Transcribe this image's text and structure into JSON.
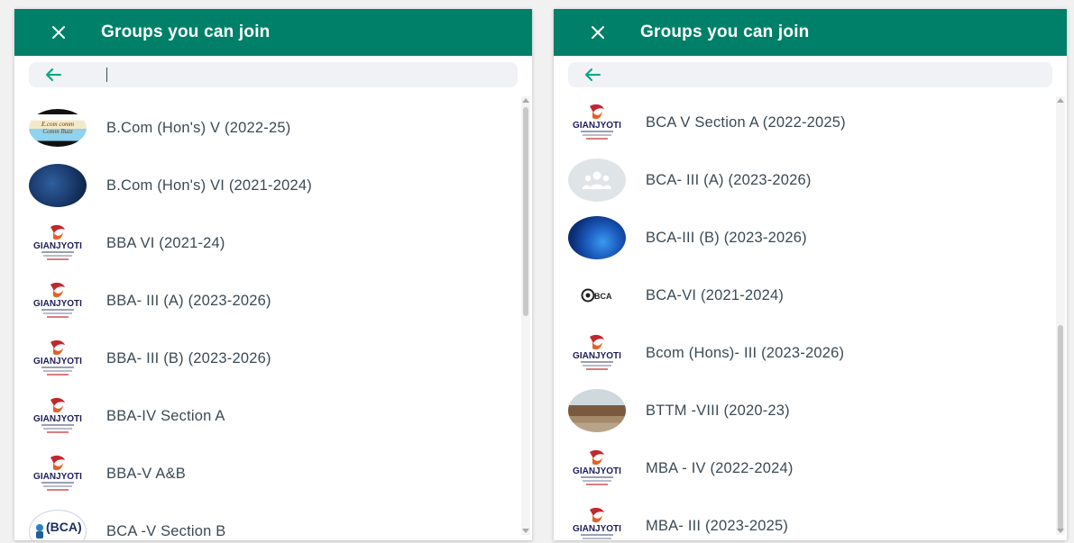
{
  "panels": [
    {
      "title": "Groups you can join",
      "search": {
        "value": "",
        "placeholder": ""
      },
      "groups": [
        {
          "name": "B.Com (Hon's) V (2022-25)",
          "avatar": "ecom-community-icon",
          "avatar_text": "E.com comm Comm Buzz"
        },
        {
          "name": "B.Com (Hon's) VI (2021-2024)",
          "avatar": "blue-abstract-photo"
        },
        {
          "name": "BBA VI (2021-24)",
          "avatar": "gianjyoti-logo-icon"
        },
        {
          "name": "BBA- III (A) (2023-2026)",
          "avatar": "gianjyoti-logo-icon"
        },
        {
          "name": "BBA- III (B) (2023-2026)",
          "avatar": "gianjyoti-logo-icon"
        },
        {
          "name": "BBA-IV Section A",
          "avatar": "gianjyoti-logo-icon"
        },
        {
          "name": "BBA-V A&B",
          "avatar": "gianjyoti-logo-icon"
        },
        {
          "name": "BCA -V Section B",
          "avatar": "bca-department-icon",
          "avatar_text": "(BCA)"
        }
      ]
    },
    {
      "title": "Groups you can join",
      "search": {
        "value": "",
        "placeholder": ""
      },
      "groups": [
        {
          "name": "BCA V Section A (2022-2025)",
          "avatar": "gianjyoti-logo-icon"
        },
        {
          "name": "BCA- III (A) (2023-2026)",
          "avatar": "default-group-icon"
        },
        {
          "name": "BCA-III (B) (2023-2026)",
          "avatar": "blue-globe-photo"
        },
        {
          "name": "BCA-VI (2021-2024)",
          "avatar": "bca-logo-icon",
          "avatar_text": "BCA"
        },
        {
          "name": "Bcom (Hons)- III (2023-2026)",
          "avatar": "gianjyoti-logo-icon"
        },
        {
          "name": "BTTM -VIII (2020-23)",
          "avatar": "campus-building-photo"
        },
        {
          "name": "MBA - IV (2022-2024)",
          "avatar": "gianjyoti-logo-icon"
        },
        {
          "name": "MBA- III (2023-2025)",
          "avatar": "gianjyoti-logo-icon"
        }
      ]
    }
  ],
  "logo": {
    "text": "GIANJYOTI"
  },
  "colors": {
    "header": "#008069",
    "accent_green": "#00a884",
    "search_bg": "#f0f2f5",
    "text": "#3b4a54",
    "logo_red": "#c0282d"
  }
}
